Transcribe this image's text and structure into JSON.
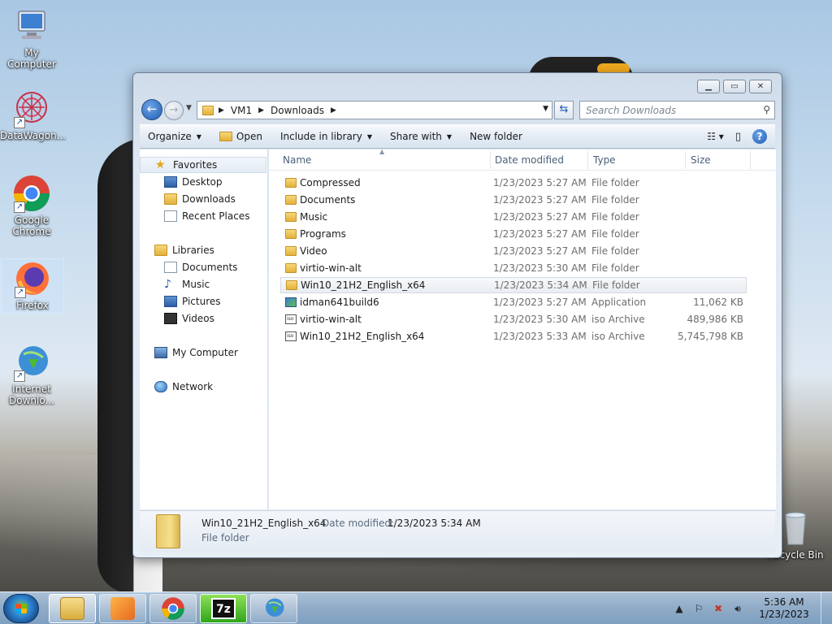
{
  "desktop": {
    "icons": [
      {
        "label": "My Computer"
      },
      {
        "label": "DataWagon..."
      },
      {
        "label": "Google Chrome"
      },
      {
        "label": "Firefox"
      },
      {
        "label": "Internet Downlo..."
      },
      {
        "label": "Recycle Bin"
      }
    ]
  },
  "window": {
    "address": {
      "crumbs": [
        "VM1",
        "Downloads"
      ],
      "search_placeholder": "Search Downloads"
    },
    "toolbar": {
      "organize": "Organize",
      "open": "Open",
      "include_in_library": "Include in library",
      "share_with": "Share with",
      "new_folder": "New folder"
    },
    "nav": {
      "favorites": "Favorites",
      "desktop": "Desktop",
      "downloads": "Downloads",
      "recent_places": "Recent Places",
      "libraries": "Libraries",
      "documents": "Documents",
      "music": "Music",
      "pictures": "Pictures",
      "videos": "Videos",
      "my_computer": "My Computer",
      "network": "Network"
    },
    "columns": {
      "name": "Name",
      "date_modified": "Date modified",
      "type": "Type",
      "size": "Size"
    },
    "files": [
      {
        "name": "Compressed",
        "date": "1/23/2023 5:27 AM",
        "type": "File folder",
        "size": "",
        "icon": "folder-icon"
      },
      {
        "name": "Documents",
        "date": "1/23/2023 5:27 AM",
        "type": "File folder",
        "size": "",
        "icon": "folder-icon"
      },
      {
        "name": "Music",
        "date": "1/23/2023 5:27 AM",
        "type": "File folder",
        "size": "",
        "icon": "folder-icon"
      },
      {
        "name": "Programs",
        "date": "1/23/2023 5:27 AM",
        "type": "File folder",
        "size": "",
        "icon": "folder-icon"
      },
      {
        "name": "Video",
        "date": "1/23/2023 5:27 AM",
        "type": "File folder",
        "size": "",
        "icon": "folder-icon"
      },
      {
        "name": "virtio-win-alt",
        "date": "1/23/2023 5:30 AM",
        "type": "File folder",
        "size": "",
        "icon": "folder-icon"
      },
      {
        "name": "Win10_21H2_English_x64",
        "date": "1/23/2023 5:34 AM",
        "type": "File folder",
        "size": "",
        "icon": "folder-icon",
        "selected": true
      },
      {
        "name": "idman641build6",
        "date": "1/23/2023 5:27 AM",
        "type": "Application",
        "size": "11,062 KB",
        "icon": "application-icon"
      },
      {
        "name": "virtio-win-alt",
        "date": "1/23/2023 5:30 AM",
        "type": "iso Archive",
        "size": "489,986 KB",
        "icon": "iso-icon"
      },
      {
        "name": "Win10_21H2_English_x64",
        "date": "1/23/2023 5:33 AM",
        "type": "iso Archive",
        "size": "5,745,798 KB",
        "icon": "iso-icon"
      }
    ],
    "details": {
      "name": "Win10_21H2_English_x64",
      "date_label": "Date modified:",
      "date_value": "1/23/2023 5:34 AM",
      "type": "File folder"
    }
  },
  "taskbar": {
    "time": "5:36 AM",
    "date": "1/23/2023",
    "seven_zip_label": "7z"
  }
}
